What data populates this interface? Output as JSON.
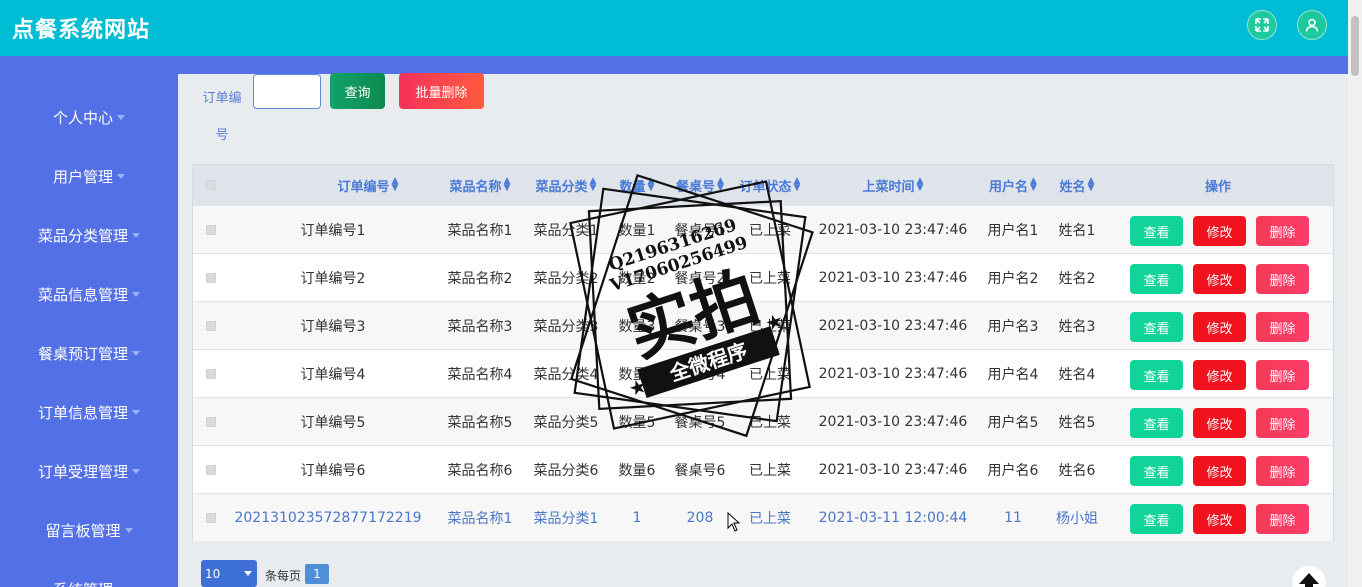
{
  "header": {
    "title": "点餐系统网站",
    "fullscreen_icon": "fullscreen-icon",
    "user_icon": "user-icon"
  },
  "sidebar": {
    "items": [
      {
        "label": "个人中心"
      },
      {
        "label": "用户管理"
      },
      {
        "label": "菜品分类管理"
      },
      {
        "label": "菜品信息管理"
      },
      {
        "label": "餐桌预订管理"
      },
      {
        "label": "订单信息管理"
      },
      {
        "label": "订单受理管理"
      },
      {
        "label": "留言板管理"
      },
      {
        "label": "系统管理"
      }
    ]
  },
  "search": {
    "label": "订单编号",
    "value": "",
    "query_button": "查询",
    "bulk_delete_button": "批量删除"
  },
  "table": {
    "headers": [
      "订单编号",
      "菜品名称",
      "菜品分类",
      "数量",
      "餐桌号",
      "订单状态",
      "上菜时间",
      "用户名",
      "姓名",
      "操作"
    ],
    "rows": [
      [
        "订单编号1",
        "菜品名称1",
        "菜品分类1",
        "数量1",
        "餐桌号1",
        "已上菜",
        "2021-03-10 23:47:46",
        "用户名1",
        "姓名1"
      ],
      [
        "订单编号2",
        "菜品名称2",
        "菜品分类2",
        "数量2",
        "餐桌号2",
        "已上菜",
        "2021-03-10 23:47:46",
        "用户名2",
        "姓名2"
      ],
      [
        "订单编号3",
        "菜品名称3",
        "菜品分类3",
        "数量3",
        "餐桌号3",
        "已上菜",
        "2021-03-10 23:47:46",
        "用户名3",
        "姓名3"
      ],
      [
        "订单编号4",
        "菜品名称4",
        "菜品分类4",
        "数量4",
        "餐桌号4",
        "已上菜",
        "2021-03-10 23:47:46",
        "用户名4",
        "姓名4"
      ],
      [
        "订单编号5",
        "菜品名称5",
        "菜品分类5",
        "数量5",
        "餐桌号5",
        "已上菜",
        "2021-03-10 23:47:46",
        "用户名5",
        "姓名5"
      ],
      [
        "订单编号6",
        "菜品名称6",
        "菜品分类6",
        "数量6",
        "餐桌号6",
        "已上菜",
        "2021-03-10 23:47:46",
        "用户名6",
        "姓名6"
      ],
      [
        "202131023572877172219",
        "菜品名称1",
        "菜品分类1",
        "1",
        "208",
        "已上菜",
        "2021-03-11 12:00:44",
        "11",
        "杨小姐"
      ]
    ],
    "actions": {
      "view": "查看",
      "edit": "修改",
      "delete": "删除"
    }
  },
  "pager": {
    "page_size": "10",
    "per_page_label": "条每页",
    "current_page": "1"
  },
  "watermark": {
    "line1": "Q2196316269",
    "line2": "V17060256499",
    "main": "实拍",
    "sub": "全微程序"
  },
  "colors": {
    "header": "#00bcd4",
    "sidebar": "#5470e6",
    "accent_blue": "#4a7bd6",
    "view": "#10d49a",
    "edit": "#f0131f",
    "delete": "#f53a55"
  }
}
